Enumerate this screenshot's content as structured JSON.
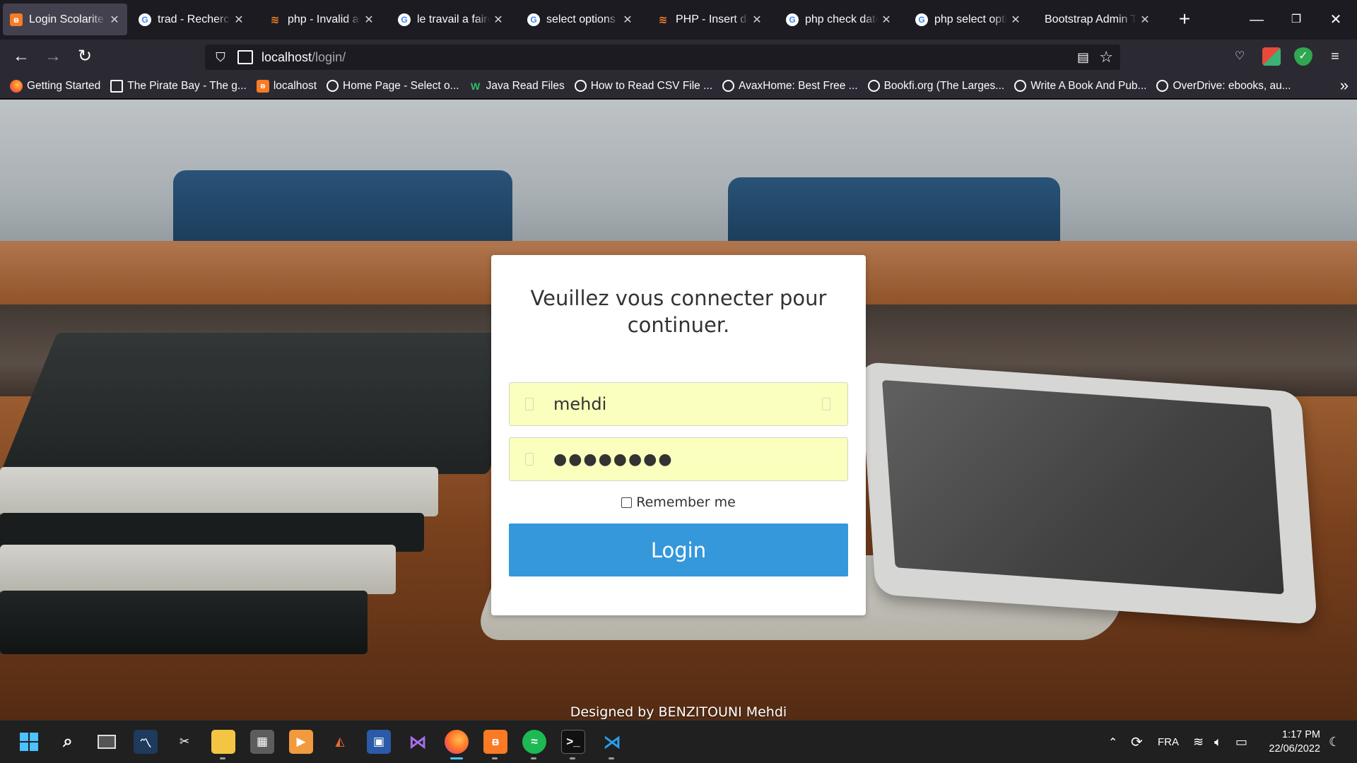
{
  "tabs": [
    {
      "title": "Login Scolarite",
      "icon": "xampp-icon",
      "active": true
    },
    {
      "title": "trad - Recherche Google",
      "icon": "google-icon",
      "active": false
    },
    {
      "title": "php - Invalid argument",
      "icon": "stackoverflow-icon",
      "active": false
    },
    {
      "title": "le travail a faire - Google",
      "icon": "google-icon",
      "active": false
    },
    {
      "title": "select options html",
      "icon": "google-icon",
      "active": false
    },
    {
      "title": "PHP - Insert date",
      "icon": "stackoverflow-icon",
      "active": false
    },
    {
      "title": "php check date google",
      "icon": "google-icon",
      "active": false
    },
    {
      "title": "php select option",
      "icon": "google-icon",
      "active": false
    },
    {
      "title": "Bootstrap Admin Theme",
      "icon": "none",
      "active": false
    }
  ],
  "nav": {
    "url_host": "localhost",
    "url_path": "/login/"
  },
  "bookmarks": [
    {
      "label": "Getting Started",
      "icon": "firefox-icon"
    },
    {
      "label": "The Pirate Bay - The g...",
      "icon": "piratebay-icon"
    },
    {
      "label": "localhost",
      "icon": "xampp-icon"
    },
    {
      "label": "Home Page - Select o...",
      "icon": "globe-icon"
    },
    {
      "label": "Java Read Files",
      "icon": "w-icon"
    },
    {
      "label": "How to Read CSV File ...",
      "icon": "globe-icon"
    },
    {
      "label": "AvaxHome: Best Free ...",
      "icon": "globe-icon"
    },
    {
      "label": "Bookfi.org (The Larges...",
      "icon": "globe-icon"
    },
    {
      "label": "Write A Book And Pub...",
      "icon": "globe-icon"
    },
    {
      "label": "OverDrive: ebooks, au...",
      "icon": "globe-icon"
    }
  ],
  "login": {
    "heading": "Veuillez vous connecter pour continuer.",
    "username_value": "mehdi",
    "password_value": "●●●●●●●●",
    "remember_label": "Remember me",
    "remember_checked": false,
    "submit_label": "Login"
  },
  "footer": {
    "credit": "Designed by BENZITOUNI Mehdi"
  },
  "taskbar": {
    "language": "FRA",
    "time": "1:17 PM",
    "date": "22/06/2022"
  },
  "colors": {
    "login_button": "#3498db",
    "autofill_field": "#faffbd",
    "browser_chrome": "#2b2a33",
    "taskbar": "#202020"
  }
}
